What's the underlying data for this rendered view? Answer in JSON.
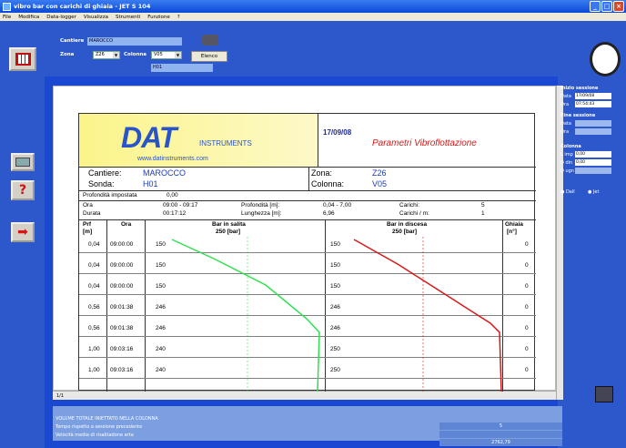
{
  "window": {
    "title": "vibro bar con carichi di ghiaia - JET S 104"
  },
  "menu": [
    "File",
    "Modifica",
    "Data-logger",
    "Visualizza",
    "Strumenti",
    "Funzione",
    "?"
  ],
  "form": {
    "cantiere_label": "Cantiere",
    "cantiere_value": "MAROCCO",
    "zona_label": "Zona",
    "zona_value": "Z26",
    "colonna_label": "Colonna",
    "colonna_value": "V05",
    "sonda_value": "H01",
    "elenco_label": "Elenco"
  },
  "report": {
    "logo_text": "DAT",
    "logo_sub": "INSTRUMENTS",
    "logo_url": "www.datinstruments.com",
    "date": "17/09/08",
    "title": "Parametri Vibroflottazione",
    "cantiere_label": "Cantiere:",
    "cantiere": "MAROCCO",
    "sonda_label": "Sonda:",
    "sonda": "H01",
    "zona_label": "Zona:",
    "zona": "Z26",
    "colonna_label": "Colonna:",
    "colonna": "V05",
    "prof_imp_label": "Profondità impostata",
    "prof_imp": "0,00",
    "ora_label": "Ora",
    "ora": "09:00 - 09:17",
    "profondita_label": "Profondità [m]:",
    "profondita": "0,04 - 7,00",
    "carichi_label": "Carichi:",
    "carichi": "5",
    "durata_label": "Durata",
    "durata": "00:17:12",
    "lunghezza_label": "Lunghezza [m]:",
    "lunghezza": "6,96",
    "carichi_m_label": "Carichi / m:",
    "carichi_m": "1",
    "col_prf": "Prf",
    "col_prf_unit": "[m]",
    "col_ora": "Ora",
    "col_salita": "Bar in salita",
    "col_salita_scale": "250 [bar]",
    "col_discesa": "Bar in discesa",
    "col_discesa_scale": "250 [bar]",
    "col_ghiaia": "Ghiaia",
    "col_ghiaia_unit": "[n°]",
    "rows": [
      {
        "prf": "0,04",
        "ora": "09:00:00",
        "salita": "150",
        "discesa": "150",
        "ghiaia": "0"
      },
      {
        "prf": "0,04",
        "ora": "09:00:00",
        "salita": "150",
        "discesa": "150",
        "ghiaia": "0"
      },
      {
        "prf": "0,04",
        "ora": "09:00:00",
        "salita": "150",
        "discesa": "150",
        "ghiaia": "0"
      },
      {
        "prf": "0,56",
        "ora": "09:01:38",
        "salita": "246",
        "discesa": "246",
        "ghiaia": "0"
      },
      {
        "prf": "0,56",
        "ora": "09:01:38",
        "salita": "246",
        "discesa": "246",
        "ghiaia": "0"
      },
      {
        "prf": "1,00",
        "ora": "09:03:16",
        "salita": "240",
        "discesa": "250",
        "ghiaia": "0"
      },
      {
        "prf": "1,00",
        "ora": "09:03:16",
        "salita": "240",
        "discesa": "250",
        "ghiaia": "0"
      }
    ]
  },
  "pager": "1/1",
  "bottom": {
    "rows": [
      {
        "label": "VOLUME TOTALE INIETTATO NELLA COLONNA",
        "value": "5"
      },
      {
        "label": "Tempo rispetto a sessione precedente",
        "value": ""
      },
      {
        "label": "Velocità media di risalitadone arta",
        "value": "2762,79"
      }
    ]
  },
  "session": {
    "inizio_label": "Inizio sessione",
    "data_label": "Data",
    "data": "17/09/08",
    "ora_label": "Ora",
    "ora": "07:54:43",
    "fine_label": "Fine sessione",
    "fine_data_label": "Data",
    "fine_ora_label": "Ora",
    "colonna_label": "Colonna",
    "l_imp_label": "L imp",
    "l_imp": "0,00",
    "d_din_label": "D din",
    "d_din": "0,00",
    "d_ugn_label": "D ugn",
    "radio1": "Dall",
    "radio2": "Jet"
  },
  "colors": {
    "salita": "#2ee050",
    "discesa": "#d81818",
    "accent": "#1a48d0"
  }
}
